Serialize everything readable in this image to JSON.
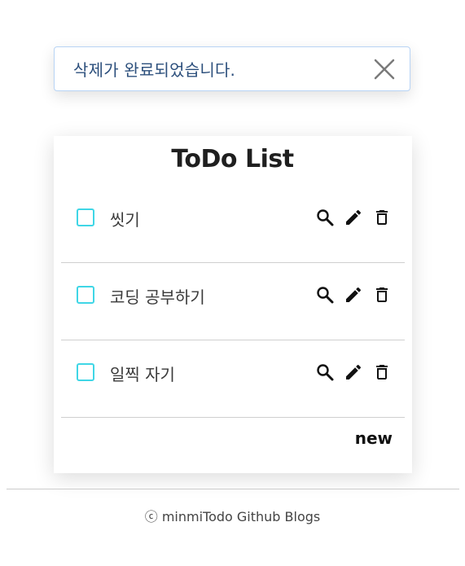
{
  "toast": {
    "message": "삭제가 완료되었습니다.",
    "close_icon": "close-icon"
  },
  "card": {
    "title": "ToDo List",
    "items": [
      {
        "label": "씻기",
        "checked": false
      },
      {
        "label": "코딩 공부하기",
        "checked": false
      },
      {
        "label": "일찍 자기",
        "checked": false
      }
    ],
    "icons": {
      "view": "search-icon",
      "edit": "pencil-icon",
      "delete": "trash-icon"
    },
    "new_label": "new"
  },
  "footer": {
    "text": "ⓒ minmiTodo Github Blogs"
  },
  "colors": {
    "toast_border": "#b8d4f5",
    "toast_text": "#2c4f7c",
    "checkbox_border": "#3fd6e6"
  }
}
